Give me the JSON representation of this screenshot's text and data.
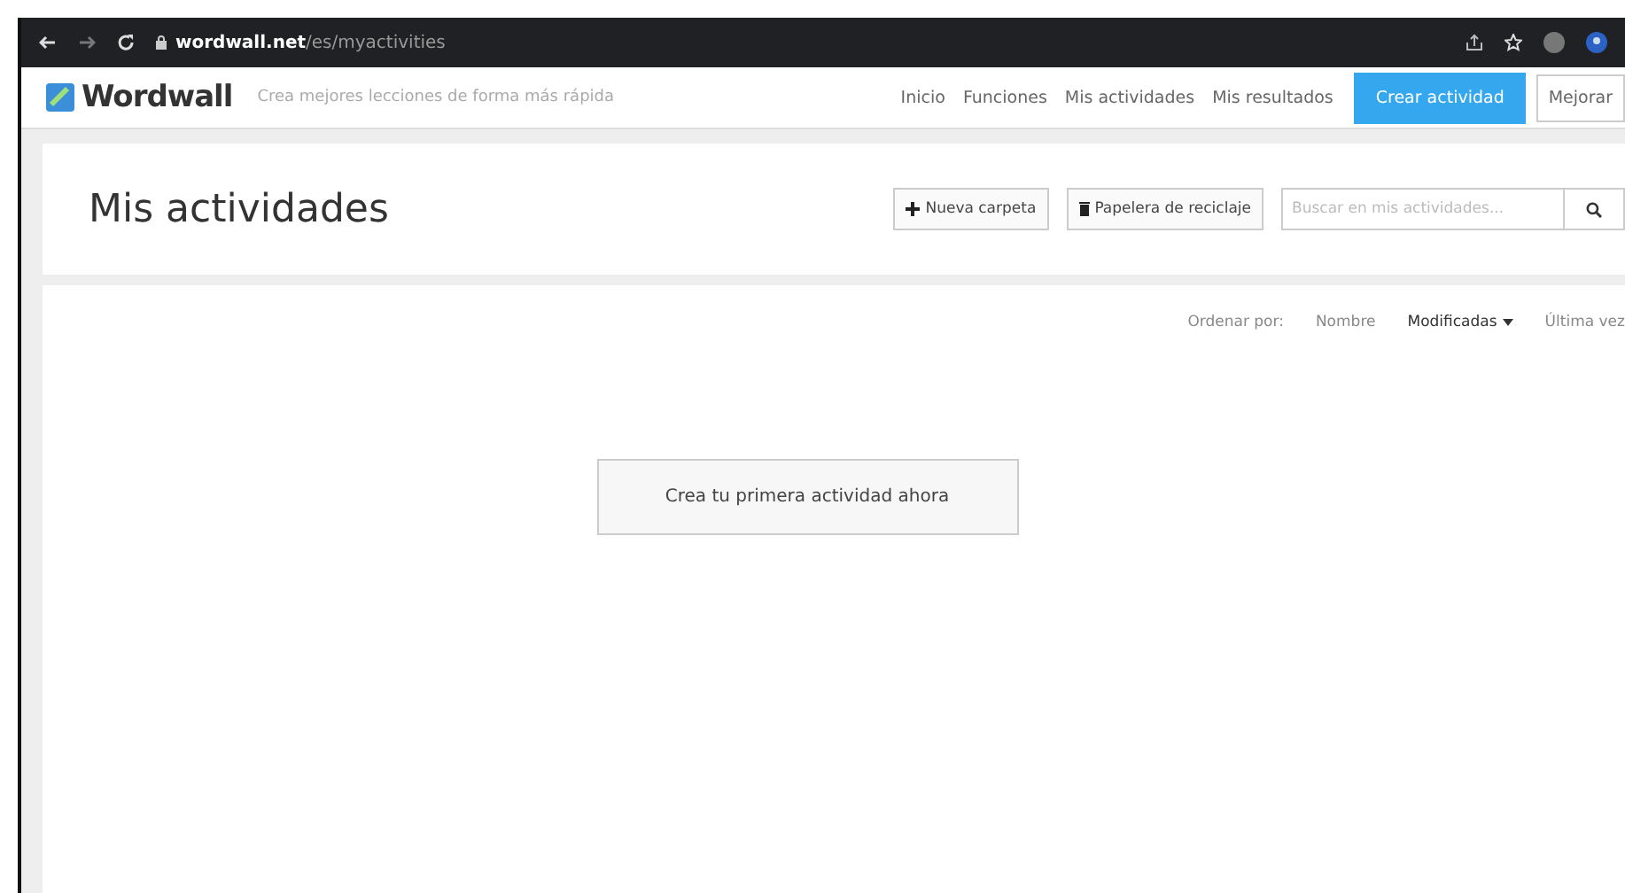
{
  "browser": {
    "url_host": "wordwall.net",
    "url_path": "/es/myactivities"
  },
  "nav": {
    "logo": "Wordwall",
    "tagline": "Crea mejores lecciones de forma más rápida",
    "links": [
      "Inicio",
      "Funciones",
      "Mis actividades",
      "Mis resultados"
    ],
    "primary_button": "Crear actividad",
    "secondary_button": "Mejorar"
  },
  "header": {
    "title": "Mis actividades",
    "new_folder": "Nueva carpeta",
    "recycle_bin": "Papelera de reciclaje",
    "search": {
      "placeholder": "Buscar en mis actividades..."
    }
  },
  "sort": {
    "label": "Ordenar por:",
    "options": [
      {
        "label": "Nombre",
        "selected": false,
        "caret": false
      },
      {
        "label": "Modificadas",
        "selected": true,
        "caret": true
      },
      {
        "label": "Última vez",
        "selected": false,
        "caret": false
      }
    ]
  },
  "empty_action": "Crea tu primera actividad ahora"
}
